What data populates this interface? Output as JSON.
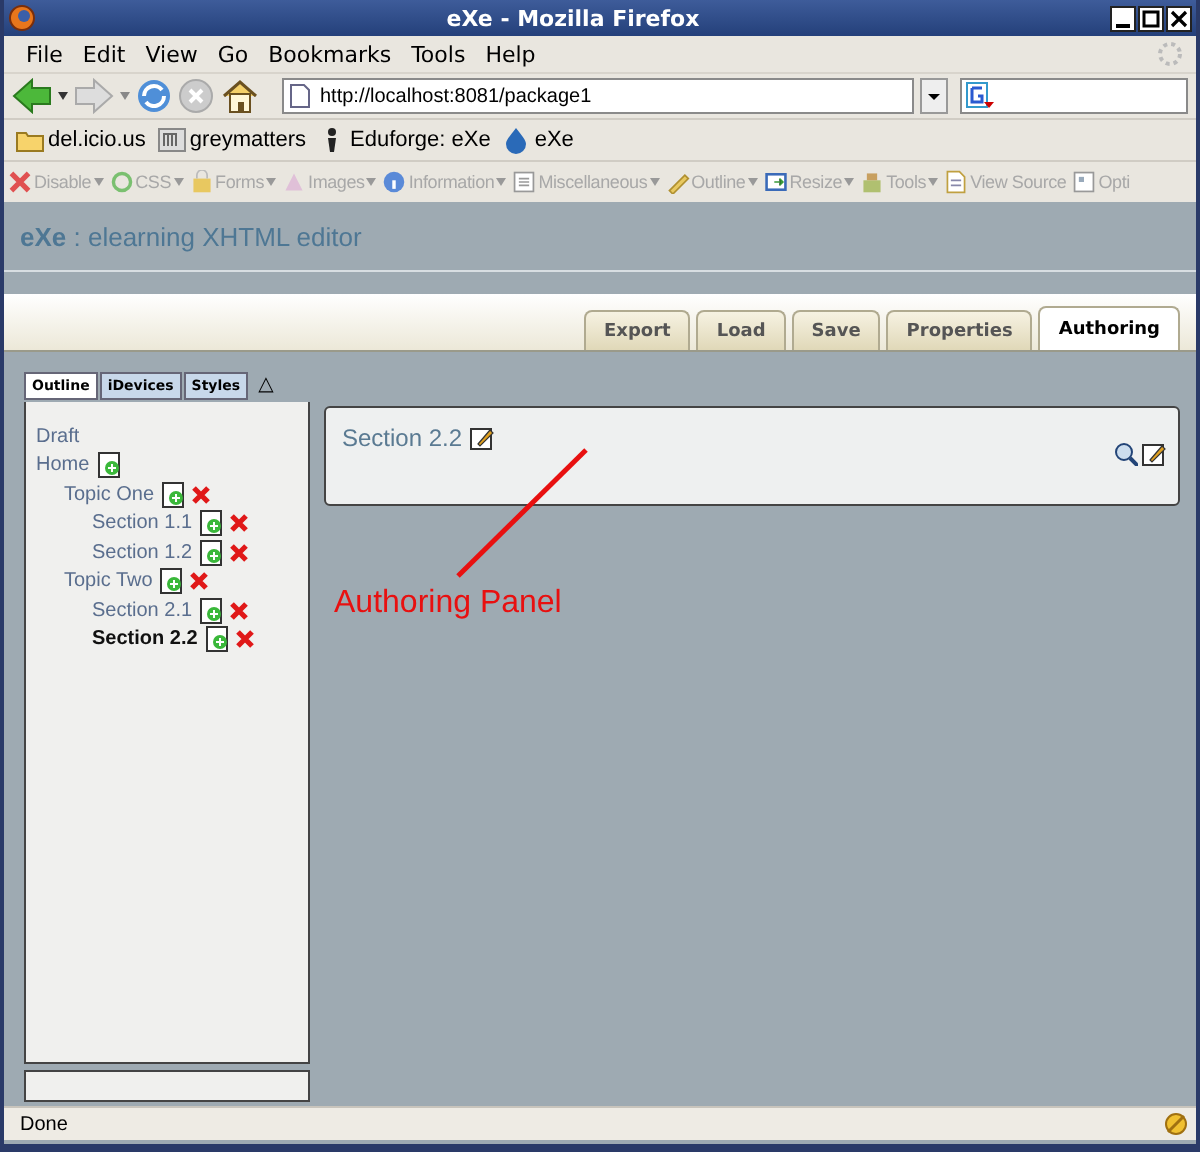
{
  "window": {
    "title": "eXe - Mozilla Firefox"
  },
  "menu": [
    "File",
    "Edit",
    "View",
    "Go",
    "Bookmarks",
    "Tools",
    "Help"
  ],
  "navigation": {
    "url": "http://localhost:8081/package1"
  },
  "bookmarks": [
    "del.icio.us",
    "greymatters",
    "Eduforge: eXe",
    "eXe"
  ],
  "dev_toolbar": [
    {
      "label": "Disable",
      "dropdown": true
    },
    {
      "label": "CSS",
      "dropdown": true
    },
    {
      "label": "Forms",
      "dropdown": true
    },
    {
      "label": "Images",
      "dropdown": true
    },
    {
      "label": "Information",
      "dropdown": true
    },
    {
      "label": "Miscellaneous",
      "dropdown": true
    },
    {
      "label": "Outline",
      "dropdown": true
    },
    {
      "label": "Resize",
      "dropdown": true
    },
    {
      "label": "Tools",
      "dropdown": true
    },
    {
      "label": "View Source",
      "dropdown": false
    },
    {
      "label": "Opti",
      "dropdown": false
    }
  ],
  "app_header": {
    "title": "**eXe** : elearning XHTML editor"
  },
  "tabs": [
    {
      "label": "Export",
      "selected": false
    },
    {
      "label": "Load",
      "selected": false
    },
    {
      "label": "Save",
      "selected": false
    },
    {
      "label": "Properties",
      "selected": false
    },
    {
      "label": "Authoring",
      "selected": true
    }
  ],
  "side_tabs": [
    {
      "label": "Outline",
      "selected": true
    },
    {
      "label": "iDevices",
      "selected": false
    },
    {
      "label": "Styles",
      "selected": false
    }
  ],
  "side_tabs_toggle": "△",
  "outline": [
    {
      "label": "Draft",
      "kind": "label",
      "selected": false
    },
    {
      "label": "Home",
      "kind": "root",
      "selected": false,
      "children": [
        {
          "label": "Topic One",
          "kind": "node",
          "selected": false,
          "children": [
            {
              "label": "Section 1.1",
              "kind": "node",
              "selected": false
            },
            {
              "label": "Section 1.2",
              "kind": "node",
              "selected": false
            }
          ]
        },
        {
          "label": "Topic Two",
          "kind": "node",
          "selected": false,
          "children": [
            {
              "label": "Section 2.1",
              "kind": "node",
              "selected": false
            },
            {
              "label": "Section 2.2",
              "kind": "node",
              "selected": true
            }
          ]
        }
      ]
    }
  ],
  "authoring_panel": {
    "title": "Section 2.2"
  },
  "annotation": "Authoring Panel",
  "status_bar": {
    "text": "Done"
  }
}
